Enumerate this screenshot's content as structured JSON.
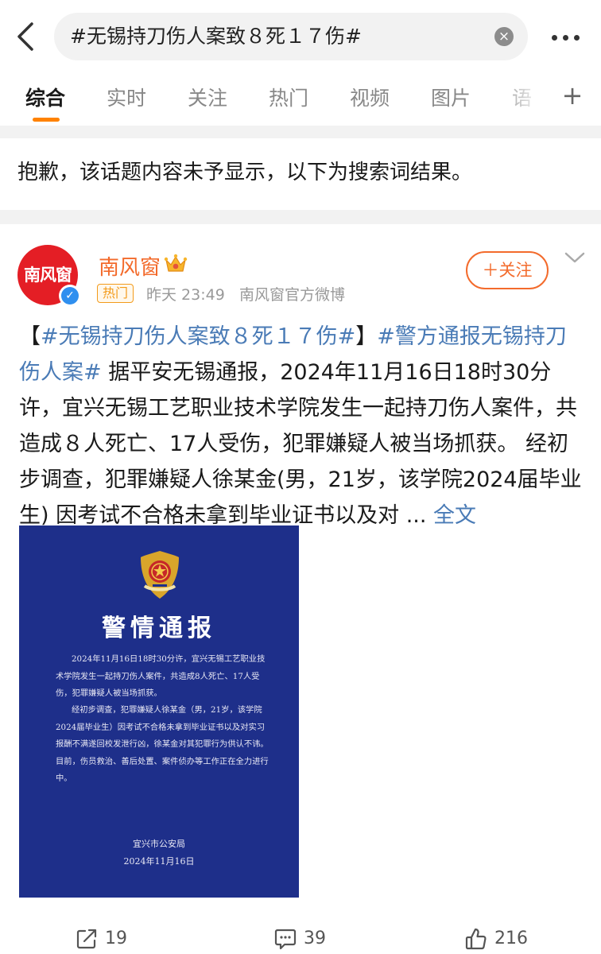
{
  "search": {
    "query": "#无锡持刀伤人案致８死１７伤#",
    "clear_symbol": "×"
  },
  "tabs": [
    {
      "label": "综合",
      "active": true
    },
    {
      "label": "实时"
    },
    {
      "label": "关注"
    },
    {
      "label": "热门"
    },
    {
      "label": "视频"
    },
    {
      "label": "图片"
    },
    {
      "label": "语"
    }
  ],
  "tab_add_symbol": "+",
  "notice": "抱歉，该话题内容未予显示，以下为搜索词结果。",
  "post": {
    "avatar_text": "南风窗",
    "author": "南风窗",
    "badge": "热门",
    "time": "昨天 23:49",
    "source": "南风窗官方微博",
    "follow_label": "＋关注",
    "text_parts": {
      "open_bracket": "【",
      "hashtag1": "#无锡持刀伤人案致８死１７伤#",
      "close_bracket": "】",
      "hashtag2": "#警方通报无锡持刀伤人案#",
      "body": " 据平安无锡通报，2024年11月16日18时30分许，宜兴无锡工艺职业技术学院发生一起持刀伤人案件，共造成８人死亡、17人受伤，犯罪嫌疑人被当场抓获。 经初步调查，犯罪嫌疑人徐某金(男，21岁，该学院2024届毕业生) 因考试不合格未拿到毕业证书以及对 ... ",
      "full_text_link": "全文"
    },
    "image": {
      "title": "警情通报",
      "paragraph1": "2024年11月16日18时30分许，宜兴无锡工艺职业技术学院发生一起持刀伤人案件，共造成8人死亡、17人受伤，犯罪嫌疑人被当场抓获。",
      "paragraph2": "经初步调查，犯罪嫌疑人徐某金（男，21岁，该学院2024届毕业生）因考试不合格未拿到毕业证书以及对实习报酬不满遂回校发泄行凶，徐某金对其犯罪行为供认不讳。目前，伤员救治、善后处置、案件侦办等工作正在全力进行中。",
      "issuer": "宜兴市公安局",
      "date": "2024年11月16日"
    },
    "actions": {
      "repost_count": "19",
      "comment_count": "39",
      "like_count": "216"
    }
  },
  "icons": {
    "back": "back-arrow-icon",
    "clear": "clear-icon",
    "more": "more-dots-icon",
    "crown": "crown-icon",
    "verified": "verified-icon",
    "chevron": "chevron-down-icon",
    "emblem": "police-emblem-icon",
    "repost": "repost-icon",
    "comment": "comment-icon",
    "like": "like-icon"
  },
  "colors": {
    "accent_orange": "#ff8200",
    "author_orange": "#f36b2c",
    "link_blue": "#4a7bb6",
    "avatar_red": "#e41e25",
    "image_blue": "#1e2f8a",
    "hot_badge": "#f39b1b"
  }
}
